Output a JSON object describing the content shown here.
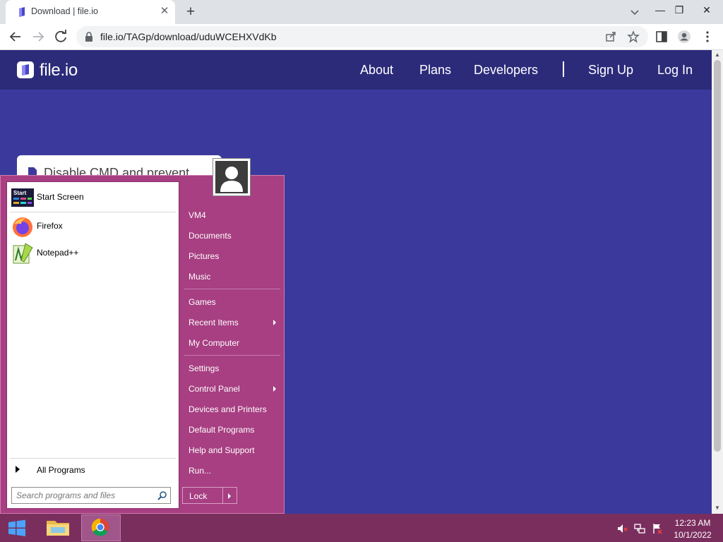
{
  "browser": {
    "tab_title": "Download | file.io",
    "url": "file.io/TAGp/download/uduWCEHXVdKb"
  },
  "site": {
    "name": "file.io",
    "nav": [
      "About",
      "Plans",
      "Developers",
      "Sign Up",
      "Log In"
    ],
    "card_text": "Disable CMD and prevent"
  },
  "start_menu": {
    "programs": [
      "Start Screen",
      "Firefox",
      "Notepad++"
    ],
    "start_screen_icon_text": "Start",
    "all_programs": "All Programs",
    "search_placeholder": "Search programs and files",
    "right_items": [
      "VM4",
      "Documents",
      "Pictures",
      "Music",
      "Games",
      "Recent Items",
      "My Computer",
      "Settings",
      "Control Panel",
      "Devices and Printers",
      "Default Programs",
      "Help and Support",
      "Run..."
    ],
    "lock_label": "Lock"
  },
  "taskbar": {
    "time": "12:23 AM",
    "date": "10/1/2022"
  },
  "colors": {
    "site_nav": "#2c2b7a",
    "site_body": "#3b3a9c",
    "start_menu": "#a73f82",
    "taskbar": "#7a2e5e"
  }
}
